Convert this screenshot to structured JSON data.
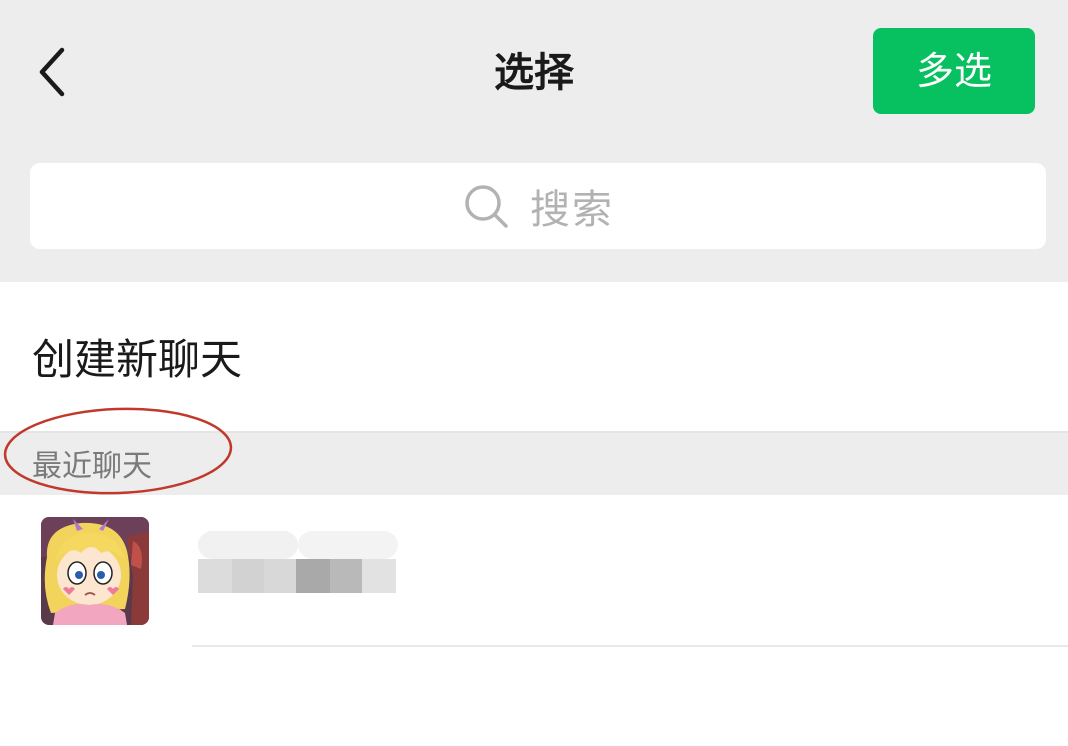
{
  "header": {
    "title": "选择",
    "back_icon": "chevron-left-icon",
    "multi_select_label": "多选",
    "accent_color": "#07c160"
  },
  "search": {
    "placeholder": "搜索",
    "icon": "search-icon"
  },
  "create_chat": {
    "label": "创建新聊天"
  },
  "recent": {
    "section_label": "最近聊天",
    "annotation_color": "#c0392b",
    "items": [
      {
        "avatar": "cartoon-girl-avatar",
        "name_obscured": true
      }
    ]
  }
}
